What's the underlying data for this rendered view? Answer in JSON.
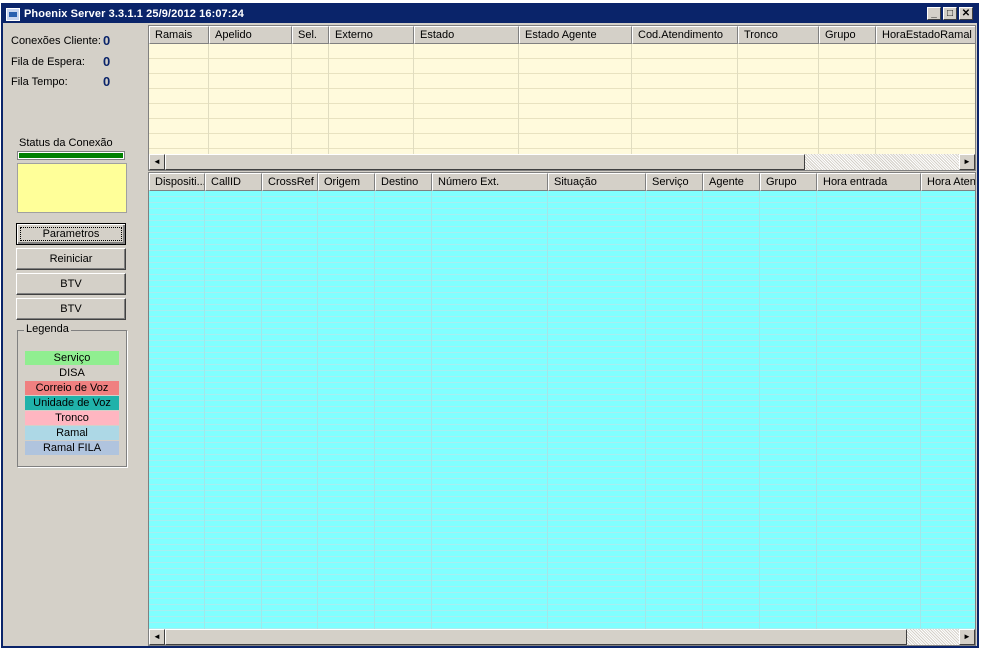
{
  "window": {
    "title": "Phoenix Server 3.3.1.1  25/9/2012 16:07:24",
    "controls": {
      "minimize": "_",
      "maximize": "□",
      "close": "✕"
    }
  },
  "stats": [
    {
      "label": "Conexões Cliente:",
      "value": "0"
    },
    {
      "label": "Fila de Espera:",
      "value": "0"
    },
    {
      "label": "Fila Tempo:",
      "value": "0"
    }
  ],
  "connection": {
    "label": "Status da Conexão",
    "progress": 1.0
  },
  "buttons": {
    "parametros": "Parametros",
    "reiniciar": "Reiniciar",
    "btv1": "BTV",
    "btv2": "BTV"
  },
  "legend": {
    "title": "Legenda",
    "items": [
      {
        "label": "Serviço",
        "color": "#90ee90"
      },
      {
        "label": "DISA",
        "color": "#d4d0c8"
      },
      {
        "label": "Correio de Voz",
        "color": "#f08080"
      },
      {
        "label": "Unidade de Voz",
        "color": "#20b2aa"
      },
      {
        "label": "Tronco",
        "color": "#ffb6c1"
      },
      {
        "label": "Ramal",
        "color": "#add8e6"
      },
      {
        "label": "Ramal FILA",
        "color": "#b0c4de"
      }
    ]
  },
  "top_grid": {
    "columns": [
      "Ramais",
      "Apelido",
      "Sel.",
      "Externo",
      "Estado",
      "Estado Agente",
      "Cod.Atendimento",
      "Tronco",
      "Grupo",
      "HoraEstadoRamal"
    ],
    "background": "#fffadc"
  },
  "bottom_grid": {
    "columns": [
      "Dispositi...",
      "CallID",
      "CrossRef",
      "Origem",
      "Destino",
      "Número Ext.",
      "Situação",
      "Serviço",
      "Agente",
      "Grupo",
      "Hora entrada",
      "Hora Atend"
    ],
    "background": "#80ffff"
  },
  "scroll": {
    "left_arrow": "◄",
    "right_arrow": "►"
  }
}
